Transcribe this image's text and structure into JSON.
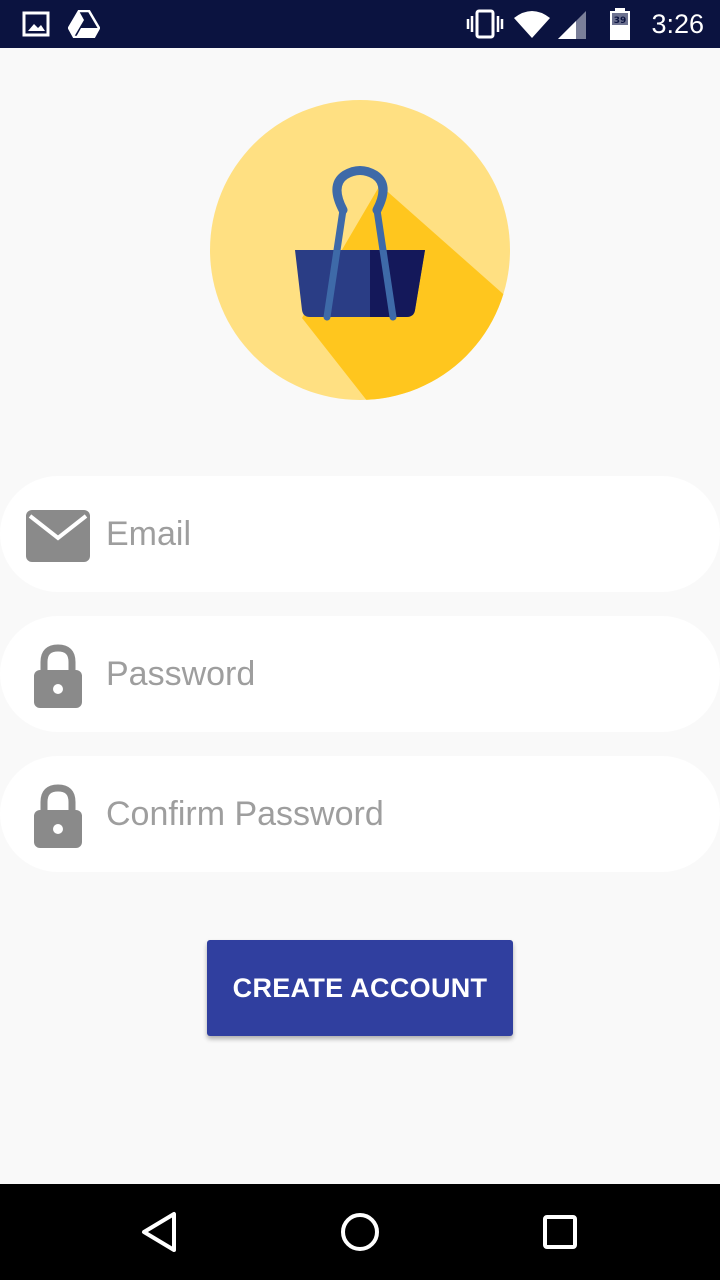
{
  "status_bar": {
    "time": "3:26",
    "battery_level": "39",
    "icons": [
      "gallery-icon",
      "drive-icon",
      "vibrate-icon",
      "wifi-icon",
      "signal-icon",
      "battery-icon"
    ]
  },
  "form": {
    "email_placeholder": "Email",
    "password_placeholder": "Password",
    "confirm_placeholder": "Confirm Password",
    "submit_label": "CREATE ACCOUNT"
  },
  "nav_bar": {
    "icons": [
      "back-icon",
      "home-icon",
      "recents-icon"
    ]
  },
  "colors": {
    "status_bar": "#0b1340",
    "background": "#f9f9f9",
    "logo_circle": "#ffe082",
    "logo_shadow": "#ffc61e",
    "clip_dark": "#1a1f5e",
    "button": "#303f9f",
    "icon_gray": "#8a8a8a",
    "placeholder": "#9e9e9e"
  }
}
